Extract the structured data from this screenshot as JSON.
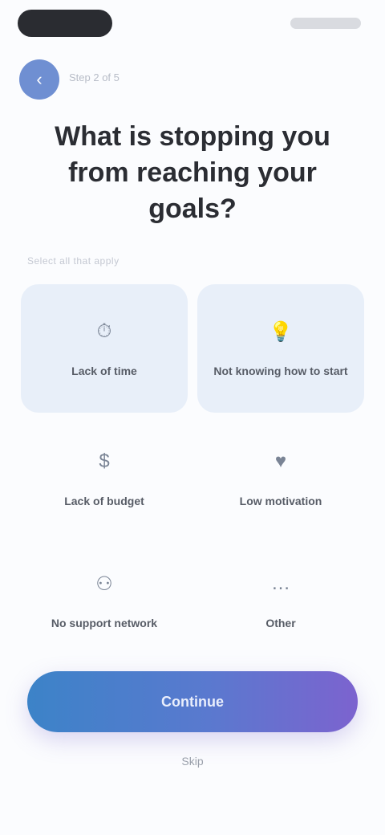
{
  "header": {
    "back_icon": "‹",
    "step_label": "Step 2 of 5"
  },
  "title": "What is stopping you from reaching your goals?",
  "section_label": "Select all that apply",
  "options": [
    {
      "icon": "clock-icon",
      "glyph": "⏱",
      "label": "Lack of time",
      "selected": true
    },
    {
      "icon": "lightbulb-icon",
      "glyph": "💡",
      "label": "Not knowing how to start",
      "selected": true
    },
    {
      "icon": "money-icon",
      "glyph": "$",
      "label": "Lack of budget",
      "selected": false
    },
    {
      "icon": "motivation-icon",
      "glyph": "♥",
      "label": "Low motivation",
      "selected": false
    },
    {
      "icon": "people-icon",
      "glyph": "⚇",
      "label": "No support network",
      "selected": false
    },
    {
      "icon": "other-icon",
      "glyph": "…",
      "label": "Other",
      "selected": false
    }
  ],
  "cta": {
    "label": "Continue"
  },
  "skip": {
    "label": "Skip"
  },
  "colors": {
    "accent_start": "#3c83c8",
    "accent_end": "#7c63cf",
    "selected_bg": "#e8eff9"
  }
}
